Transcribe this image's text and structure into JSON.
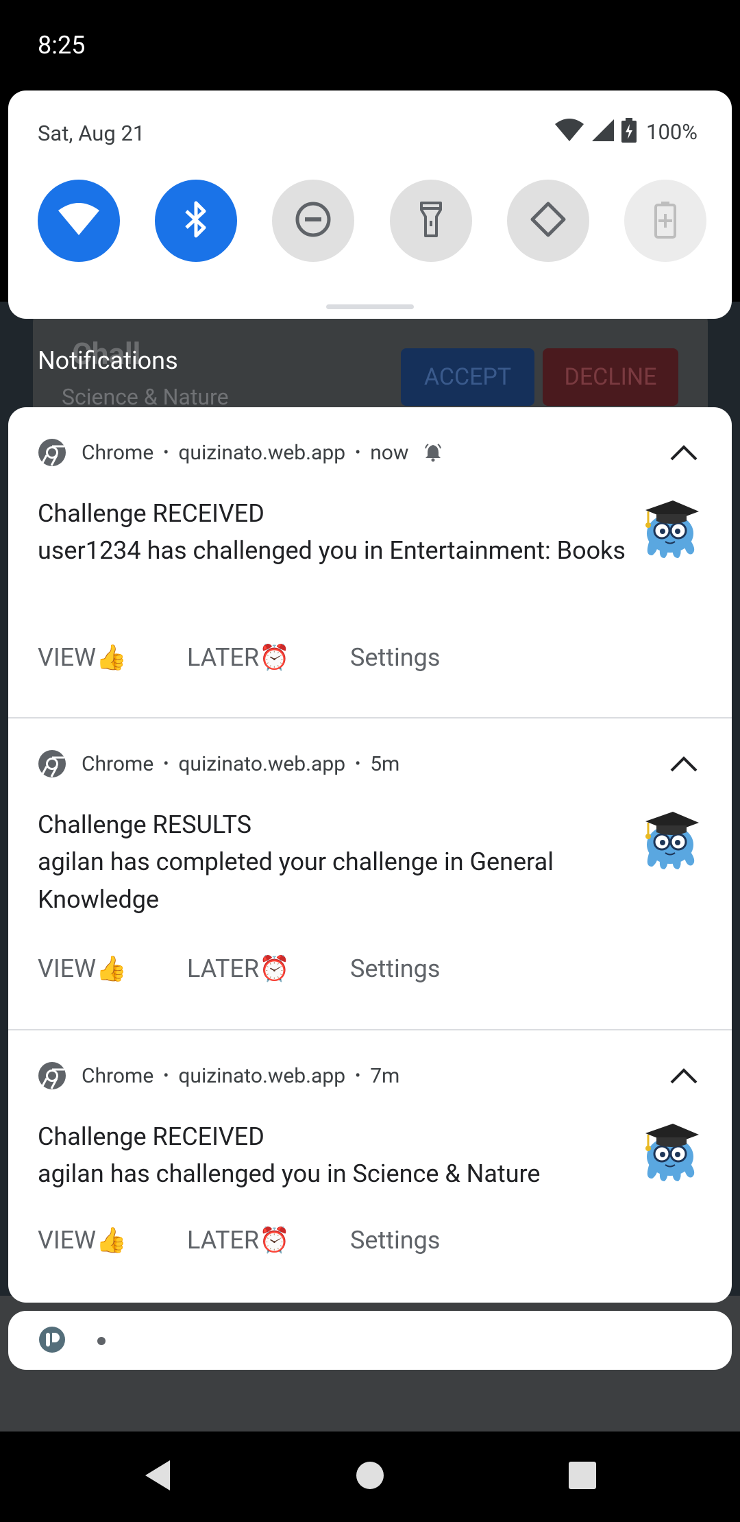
{
  "status_bar": {
    "time": "8:25"
  },
  "quick_settings": {
    "date": "Sat, Aug 21",
    "battery": "100%",
    "tiles": [
      {
        "name": "wifi",
        "state": "on"
      },
      {
        "name": "bluetooth",
        "state": "on"
      },
      {
        "name": "do-not-disturb",
        "state": "off"
      },
      {
        "name": "flashlight",
        "state": "off"
      },
      {
        "name": "auto-rotate",
        "state": "off"
      },
      {
        "name": "battery-saver",
        "state": "disabled"
      }
    ]
  },
  "background_app": {
    "card_title": "Chall",
    "card_subtitle": "Science & Nature",
    "accept_label": "ACCEPT",
    "decline_label": "DECLINE"
  },
  "notifications_header": "Notifications",
  "notifications": [
    {
      "app": "Chrome",
      "site": "quizinato.web.app",
      "time": "now",
      "title": "Challenge RECEIVED",
      "body": "user1234 has challenged you in Entertainment: Books",
      "actions": {
        "view": "VIEW👍",
        "later": "LATER⏰",
        "settings": "Settings"
      }
    },
    {
      "app": "Chrome",
      "site": "quizinato.web.app",
      "time": "5m",
      "title": "Challenge RESULTS",
      "body": "agilan has completed your challenge in General Knowledge",
      "actions": {
        "view": "VIEW👍",
        "later": "LATER⏰",
        "settings": "Settings"
      }
    },
    {
      "app": "Chrome",
      "site": "quizinato.web.app",
      "time": "7m",
      "title": "Challenge RECEIVED",
      "body": "agilan has challenged you in Science & Nature",
      "actions": {
        "view": "VIEW👍",
        "later": "LATER⏰",
        "settings": "Settings"
      }
    }
  ],
  "colors": {
    "accent": "#1a73e8",
    "tile_off": "#e0e0e0",
    "shade_bg": "#000000",
    "card_bg": "#ffffff"
  }
}
